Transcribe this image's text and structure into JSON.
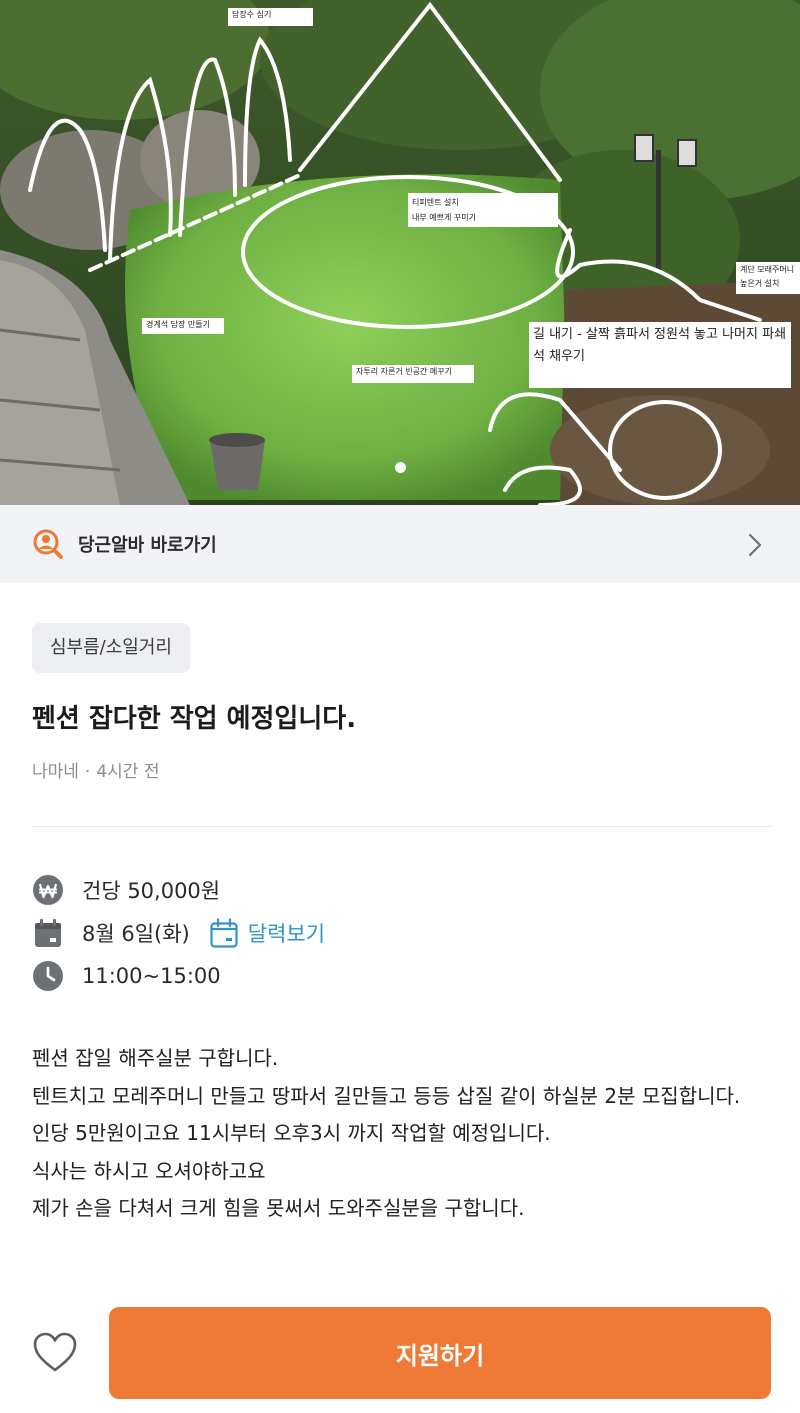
{
  "photo": {
    "notes": {
      "tree": "담장수 심기",
      "tent_line1": "티피텐트 설치",
      "tent_line2": "내부 예쁘게 꾸미기",
      "wall": "경계석 담장 만들기",
      "gravel": "자투리 자른거 빈공간 메꾸기",
      "stairs_line1": "계단 모래주머니",
      "stairs_line2": "높은거 설치",
      "path": "길 내기 - 살짝 흙파서 정원석 놓고 나머지 파쇄석 채우기"
    }
  },
  "shortcut": {
    "label": "당근알바 바로가기",
    "icon": "search-person-icon"
  },
  "post": {
    "tag": "심부름/소일거리",
    "title": "펜션 잡다한 작업 예정입니다.",
    "author": "나마네",
    "separator": "·",
    "time": "4시간 전"
  },
  "details": {
    "pay": "건당 50,000원",
    "date": "8월 6일(화)",
    "calendar_link": "달력보기",
    "hours": "11:00~15:00"
  },
  "description": [
    "펜션 잡일 해주실분 구합니다.",
    "텐트치고 모레주머니 만들고 땅파서 길만들고 등등 삽질 같이 하실분 2분 모집합니다.",
    "인당 5만원이고요 11시부터 오후3시 까지 작업할 예정입니다.",
    "식사는 하시고 오셔야하고요",
    "제가 손을 다쳐서 크게 힘을 못써서 도와주실분을 구합니다."
  ],
  "actions": {
    "apply": "지원하기"
  },
  "colors": {
    "accent": "#ee7a36",
    "link": "#2f95c9",
    "icon_gray": "#6e7077"
  }
}
